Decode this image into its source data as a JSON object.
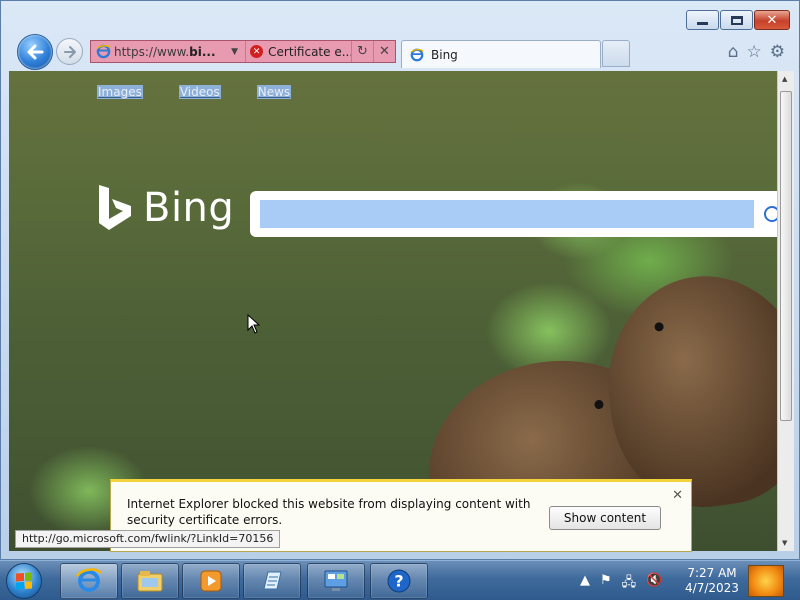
{
  "window": {
    "address_url_prefix": "https://www.",
    "address_url_host": "bi...",
    "certificate_label": "Certificate e...",
    "tab_title": "Bing"
  },
  "page": {
    "nav_links": [
      "Images",
      "Videos",
      "News"
    ],
    "logo_text": "Bing",
    "search_value": ""
  },
  "status_bar": {
    "url": "http://go.microsoft.com/fwlink/?LinkId=70156"
  },
  "notification": {
    "message": "Internet Explorer blocked this website from displaying content with security certificate errors.",
    "button_label": "Show content"
  },
  "taskbar": {
    "time": "7:27 AM",
    "date": "4/7/2023"
  },
  "colors": {
    "address_error_bg": "#e89bb0",
    "notification_stripe": "#f2d33b",
    "accent": "#2e7fd8"
  }
}
